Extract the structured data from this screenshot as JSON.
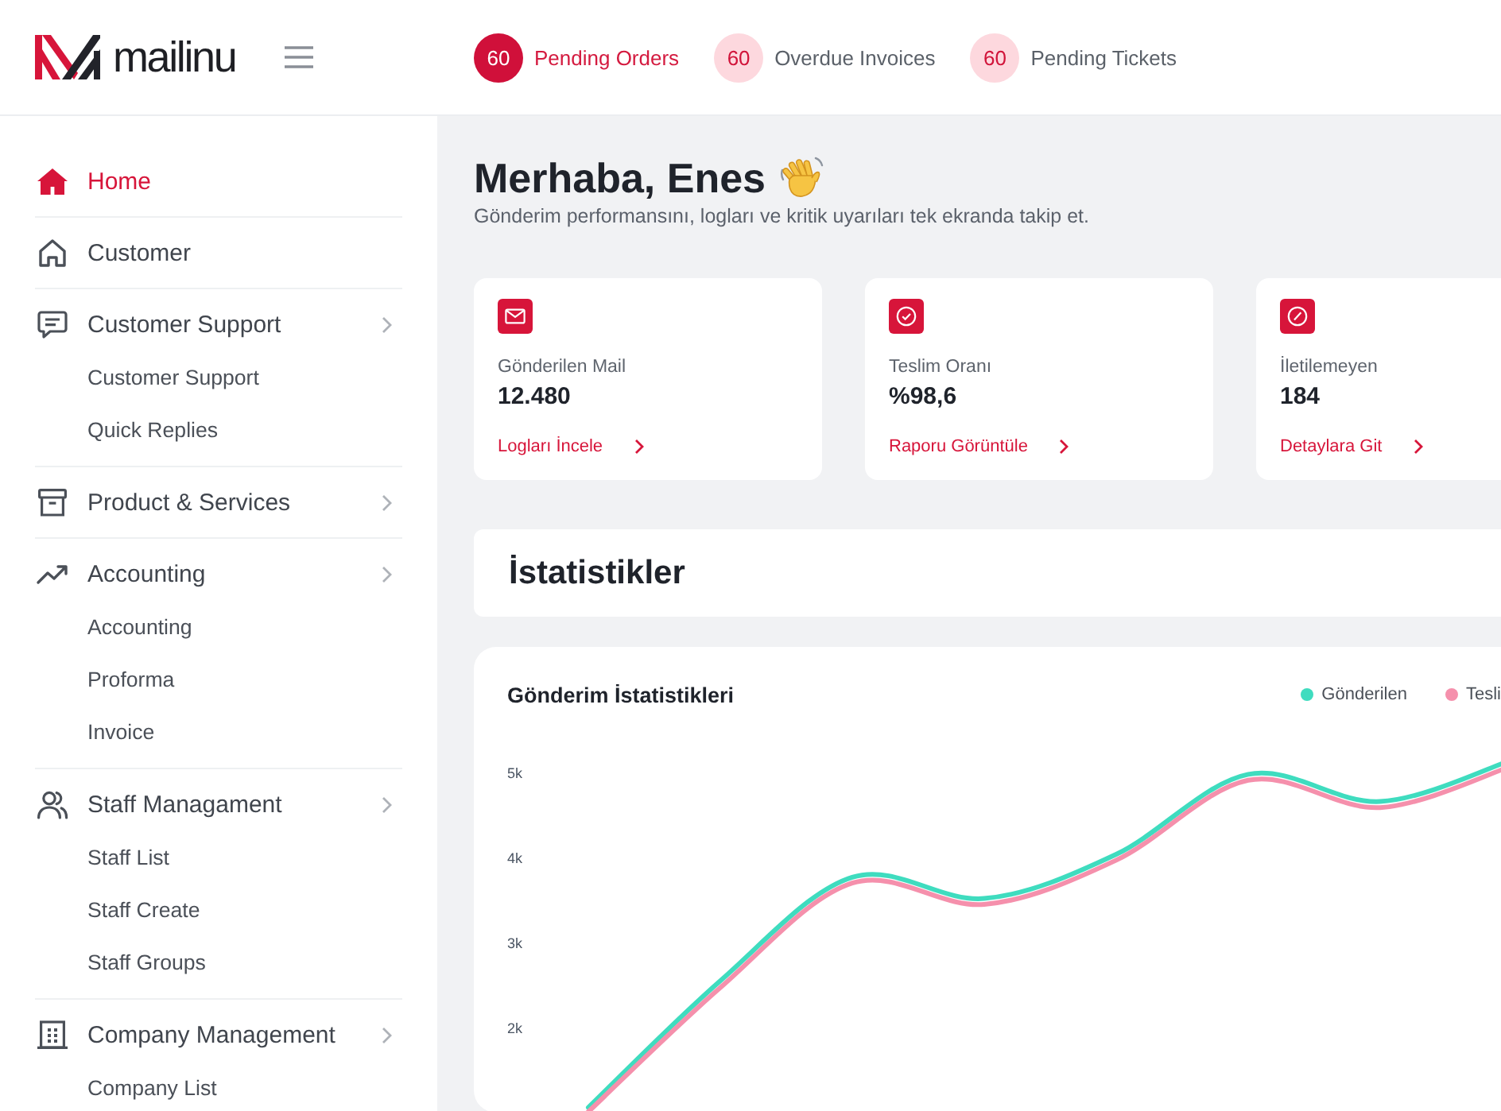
{
  "topbar": {
    "logo": "mailinu",
    "counters": [
      {
        "count": "60",
        "label": "Pending Orders",
        "selected": true
      },
      {
        "count": "60",
        "label": "Overdue Invoices",
        "selected": false
      },
      {
        "count": "60",
        "label": "Pending Tickets",
        "selected": false
      }
    ]
  },
  "sidebar": {
    "items": [
      {
        "label": "Home",
        "kind": "link",
        "selected": true
      },
      {
        "label": "Customer",
        "kind": "link",
        "selected": false
      },
      {
        "label": "Customer Support",
        "kind": "group",
        "selected": false,
        "children": [
          {
            "label": "Customer Support",
            "selected": false
          },
          {
            "label": "Quick Replies",
            "selected": false
          }
        ]
      },
      {
        "label": "Product & Services",
        "kind": "group",
        "selected": false
      },
      {
        "label": "Accounting",
        "kind": "group",
        "selected": false,
        "children": [
          {
            "label": "Accounting",
            "selected": false
          },
          {
            "label": "Proforma",
            "selected": false
          },
          {
            "label": "Invoice",
            "selected": false
          }
        ]
      },
      {
        "label": "Staff Managament",
        "kind": "group",
        "selected": false,
        "children": [
          {
            "label": "Staff List",
            "selected": false
          },
          {
            "label": "Staff Create",
            "selected": false
          },
          {
            "label": "Staff Groups",
            "selected": false
          }
        ]
      },
      {
        "label": "Company Management",
        "kind": "group",
        "selected": false,
        "children": [
          {
            "label": "Company List",
            "selected": false
          }
        ]
      }
    ]
  },
  "header": {
    "greeting": "Merhaba, Enes",
    "subtitle": "Gönderim performansını, logları ve kritik uyarıları tek ekranda takip et."
  },
  "stat_cards": [
    {
      "label": "Gönderilen Mail",
      "value": "12.480",
      "link": "Logları İncele"
    },
    {
      "label": "Teslim Oranı",
      "value": "%98,6",
      "link": "Raporu Görüntüle"
    },
    {
      "label": "İletilemeyen",
      "value": "184",
      "link": "Detaylara Git"
    }
  ],
  "section_title": "İstatistikler",
  "stats_chart": {
    "chart_data": {
      "type": "line",
      "title": "Gönderim İstatistikleri",
      "legend": "top-right",
      "categories": [
        null,
        null,
        null,
        null,
        null,
        null,
        null,
        null
      ],
      "ylim": [
        1000,
        6480
      ],
      "yticks": [
        {
          "value": 2000,
          "label": "2k"
        },
        {
          "value": 3000,
          "label": "3k"
        },
        {
          "value": 4000,
          "label": "4k"
        },
        {
          "value": 5000,
          "label": "5k"
        }
      ],
      "series": [
        {
          "name": "Gönderilen",
          "color": "#3fdcbf",
          "values": [
            1060,
            2550,
            3770,
            3520,
            4040,
            4980,
            4660,
            5150
          ]
        },
        {
          "name": "Tesli",
          "color": "#f590ac",
          "values": [
            1010,
            2470,
            3700,
            3450,
            3970,
            4910,
            4590,
            5080
          ]
        }
      ]
    }
  }
}
